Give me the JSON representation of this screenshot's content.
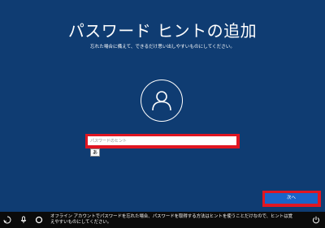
{
  "page": {
    "title": "パスワード ヒントの追加",
    "subtitle": "忘れた場合に備えて、できるだけ思い出しやすいものにしてください。"
  },
  "form": {
    "hint_placeholder": "パスワードのヒント",
    "hint_value": "",
    "ime_mode": "あ"
  },
  "actions": {
    "next_label": "次へ"
  },
  "taskbar": {
    "icons": [
      "ease-of-access-icon",
      "microphone-icon",
      "cortana-icon",
      "power-icon"
    ],
    "message": "オフライン アカウントでパスワードを忘れた場合、パスワードを取得する方法はヒントを使うことだけなので、ヒントは覚えやすいものにしてください。"
  },
  "colors": {
    "background": "#0f3c72",
    "accent": "#1a64c8",
    "highlight": "#e01622",
    "taskbar": "#0b0b0b"
  }
}
